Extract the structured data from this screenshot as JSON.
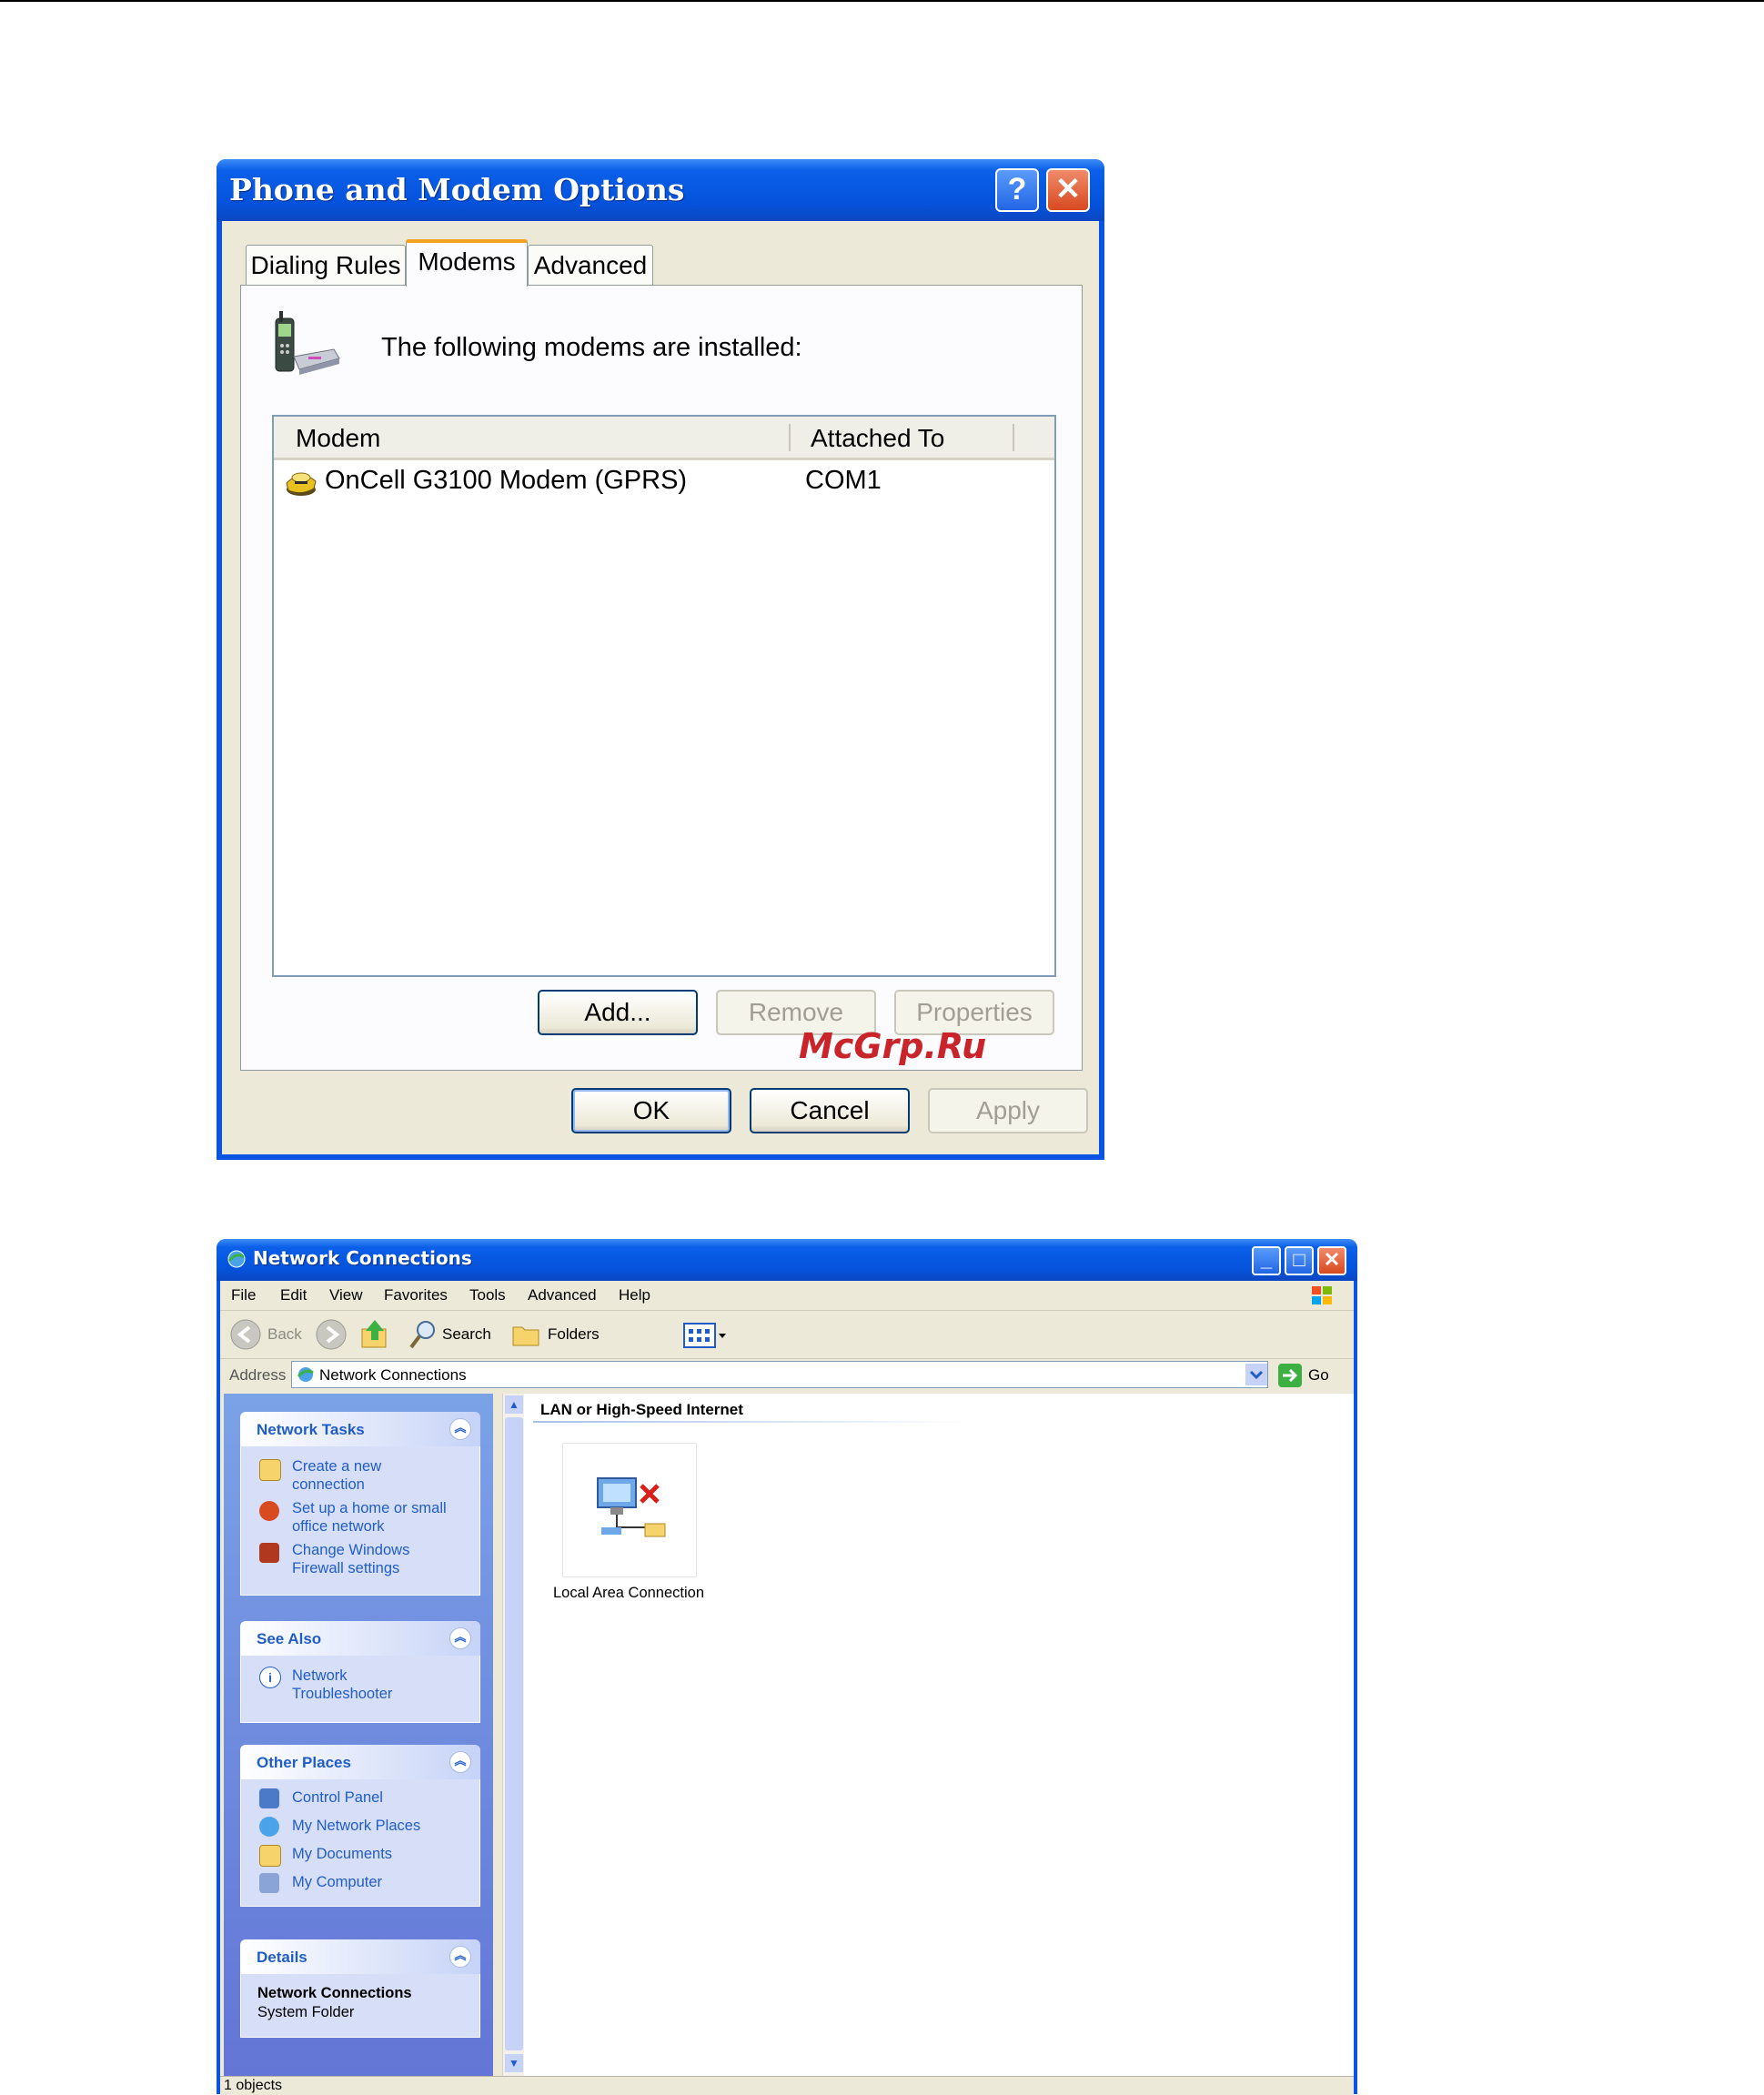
{
  "dialog": {
    "title": "Phone and Modem Options",
    "help_glyph": "?",
    "close_glyph": "✕",
    "tabs": [
      {
        "label": "Dialing Rules",
        "active": false
      },
      {
        "label": "Modems",
        "active": true
      },
      {
        "label": "Advanced",
        "active": false
      }
    ],
    "intro_text": "The following modems are  installed:",
    "columns": [
      "Modem",
      "Attached To"
    ],
    "rows": [
      {
        "modem": "OnCell G3100 Modem (GPRS)",
        "attached_to": "COM1"
      }
    ],
    "buttons": {
      "add": "Add...",
      "remove": "Remove",
      "properties": "Properties",
      "ok": "OK",
      "cancel": "Cancel",
      "apply": "Apply"
    },
    "icons": {
      "phone": "phone-modem-icon",
      "modem_row": "modem-icon"
    }
  },
  "watermark": "McGrp.Ru",
  "explorer": {
    "title": "Network Connections",
    "window_buttons": {
      "minimize": "_",
      "maximize": "□",
      "close": "✕"
    },
    "menu": [
      "File",
      "Edit",
      "View",
      "Favorites",
      "Tools",
      "Advanced",
      "Help"
    ],
    "toolbar": {
      "back": "Back",
      "search": "Search",
      "folders": "Folders"
    },
    "address": {
      "label": "Address",
      "value": "Network Connections",
      "go": "Go"
    },
    "panels": {
      "network_tasks": {
        "title": "Network Tasks",
        "links": [
          [
            "Create a new",
            "connection"
          ],
          [
            "Set up a home or small",
            "office network"
          ],
          [
            "Change Windows",
            "Firewall settings"
          ]
        ]
      },
      "see_also": {
        "title": "See Also",
        "links": [
          [
            "Network",
            "Troubleshooter"
          ]
        ]
      },
      "other_places": {
        "title": "Other Places",
        "links": [
          "Control Panel",
          "My Network Places",
          "My Documents",
          "My Computer"
        ]
      },
      "details": {
        "title": "Details",
        "name": "Network Connections",
        "type": "System Folder"
      }
    },
    "group_header": "LAN or High-Speed Internet",
    "items": [
      {
        "label": "Local Area Connection"
      }
    ],
    "status": "1 objects",
    "colors": {
      "xp_blue": "#0a54e3",
      "link": "#215dc6"
    }
  }
}
